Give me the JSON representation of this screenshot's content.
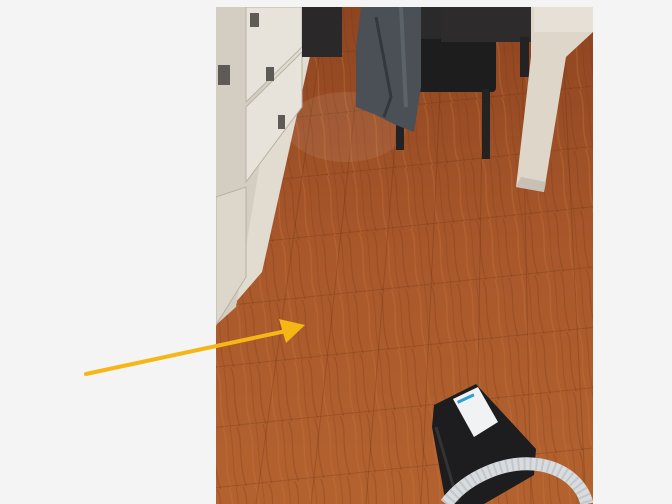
{
  "viewer": {
    "background_color": "#f4f4f4"
  },
  "photo": {
    "subjects": [
      "wood-laminate-floor",
      "kitchen-cabinet",
      "dining-chair",
      "hanging-jacket",
      "table-leg",
      "robot-vacuum-base",
      "vacuum-hose"
    ],
    "floor_color": "#a5542a",
    "cabinet_color": "#e3ddd2"
  },
  "annotation": {
    "arrow_color": "#f5b616"
  }
}
